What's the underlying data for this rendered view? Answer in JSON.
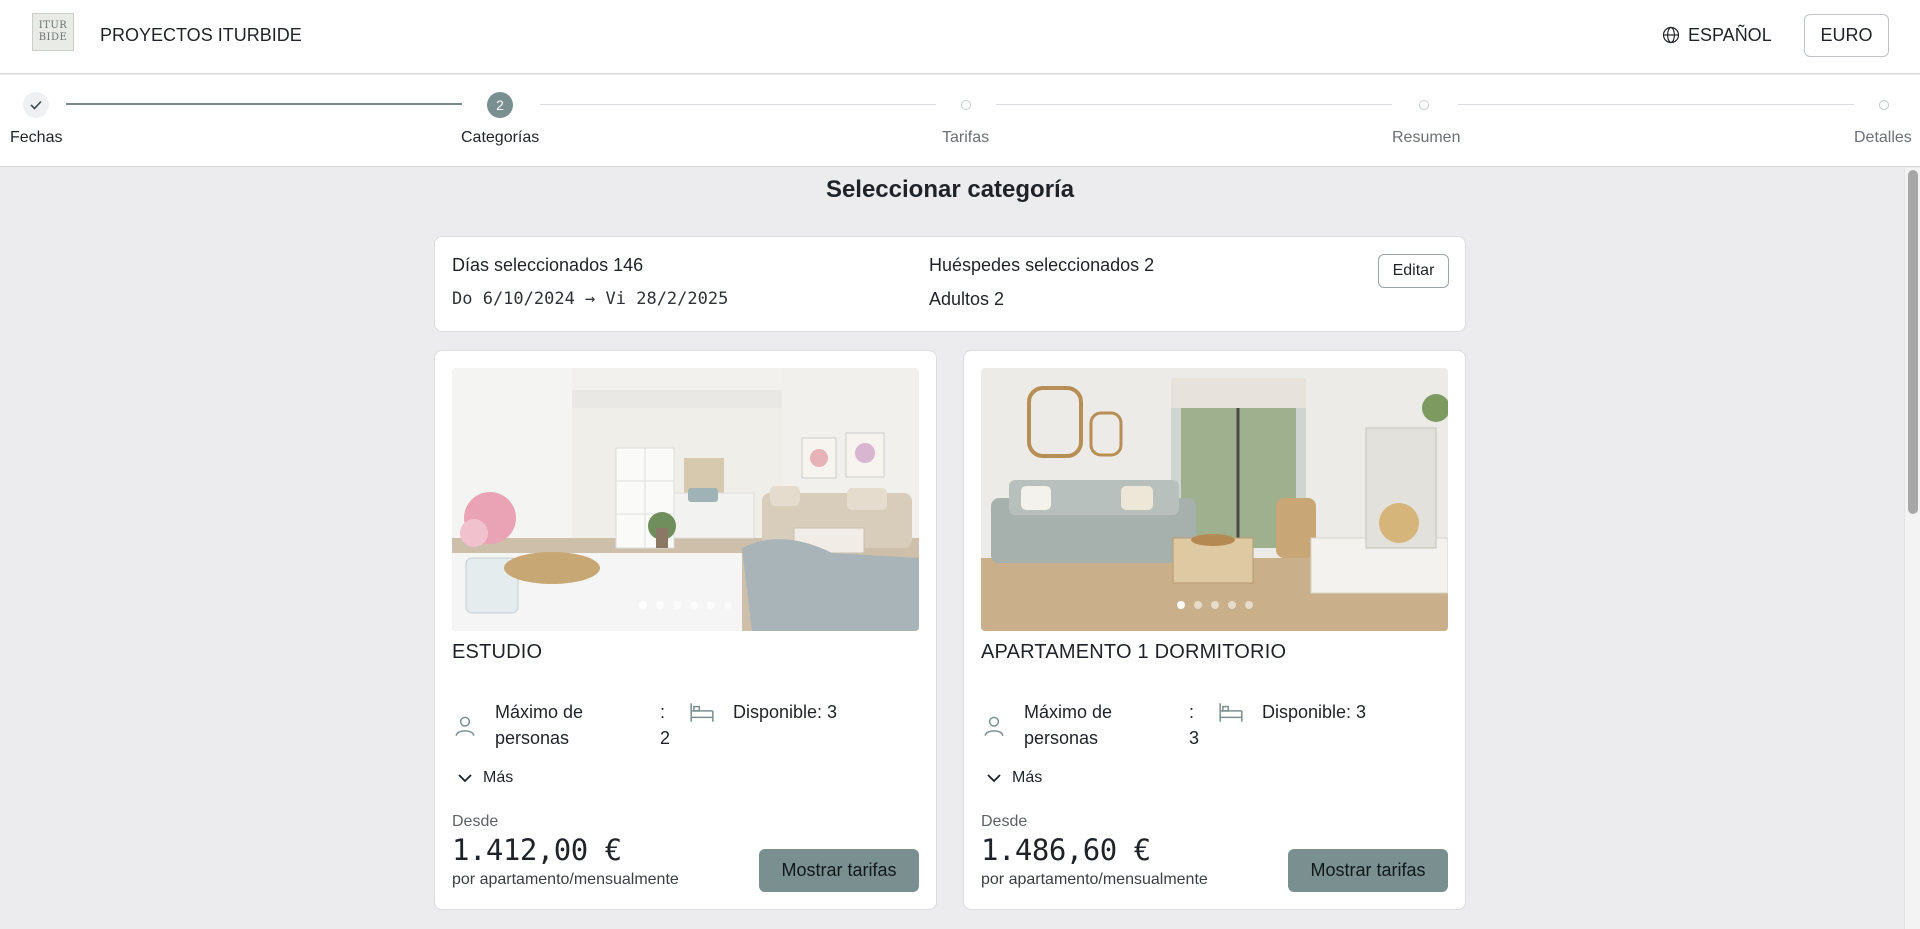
{
  "header": {
    "logo_text_line1": "ITUR",
    "logo_text_line2": "BIDE",
    "brand": "PROYECTOS ITURBIDE",
    "language": "ESPAÑOL",
    "currency": "EURO"
  },
  "stepper": {
    "steps": [
      {
        "label": "Fechas",
        "state": "done",
        "marker": "✓"
      },
      {
        "label": "Categorías",
        "state": "current",
        "marker": "2"
      },
      {
        "label": "Tarifas",
        "state": "pending"
      },
      {
        "label": "Resumen",
        "state": "pending"
      },
      {
        "label": "Detalles",
        "state": "pending"
      }
    ]
  },
  "main": {
    "title": "Seleccionar categoría",
    "summary": {
      "days_label": "Días seleccionados 146",
      "range": "Do 6/10/2024 → Vi 28/2/2025",
      "guests_label": "Huéspedes seleccionados 2",
      "adults": "Adultos 2",
      "edit_label": "Editar"
    },
    "cards": [
      {
        "title": "ESTUDIO",
        "max_label_1": "Máximo de",
        "max_label_2": "personas",
        "colon": ":",
        "max_value": "2",
        "available": "Disponible: 3",
        "more": "Más",
        "from": "Desde",
        "price": "1.412,00 €",
        "per": "por apartamento/mensualmente",
        "button": "Mostrar tarifas",
        "image_dots": 6,
        "active_dot": 0
      },
      {
        "title": "APARTAMENTO 1 DORMITORIO",
        "max_label_1": "Máximo de",
        "max_label_2": "personas",
        "colon": ":",
        "max_value": "3",
        "available": "Disponible: 3",
        "more": "Más",
        "from": "Desde",
        "price": "1.486,60 €",
        "per": "por apartamento/mensualmente",
        "button": "Mostrar tarifas",
        "image_dots": 5,
        "active_dot": 0
      }
    ]
  },
  "colors": {
    "accent": "#7a8f90",
    "background": "#ececee",
    "card": "#ffffff"
  },
  "icons": [
    "globe-icon",
    "check-icon",
    "person-icon",
    "bed-icon",
    "chevron-down-icon"
  ]
}
